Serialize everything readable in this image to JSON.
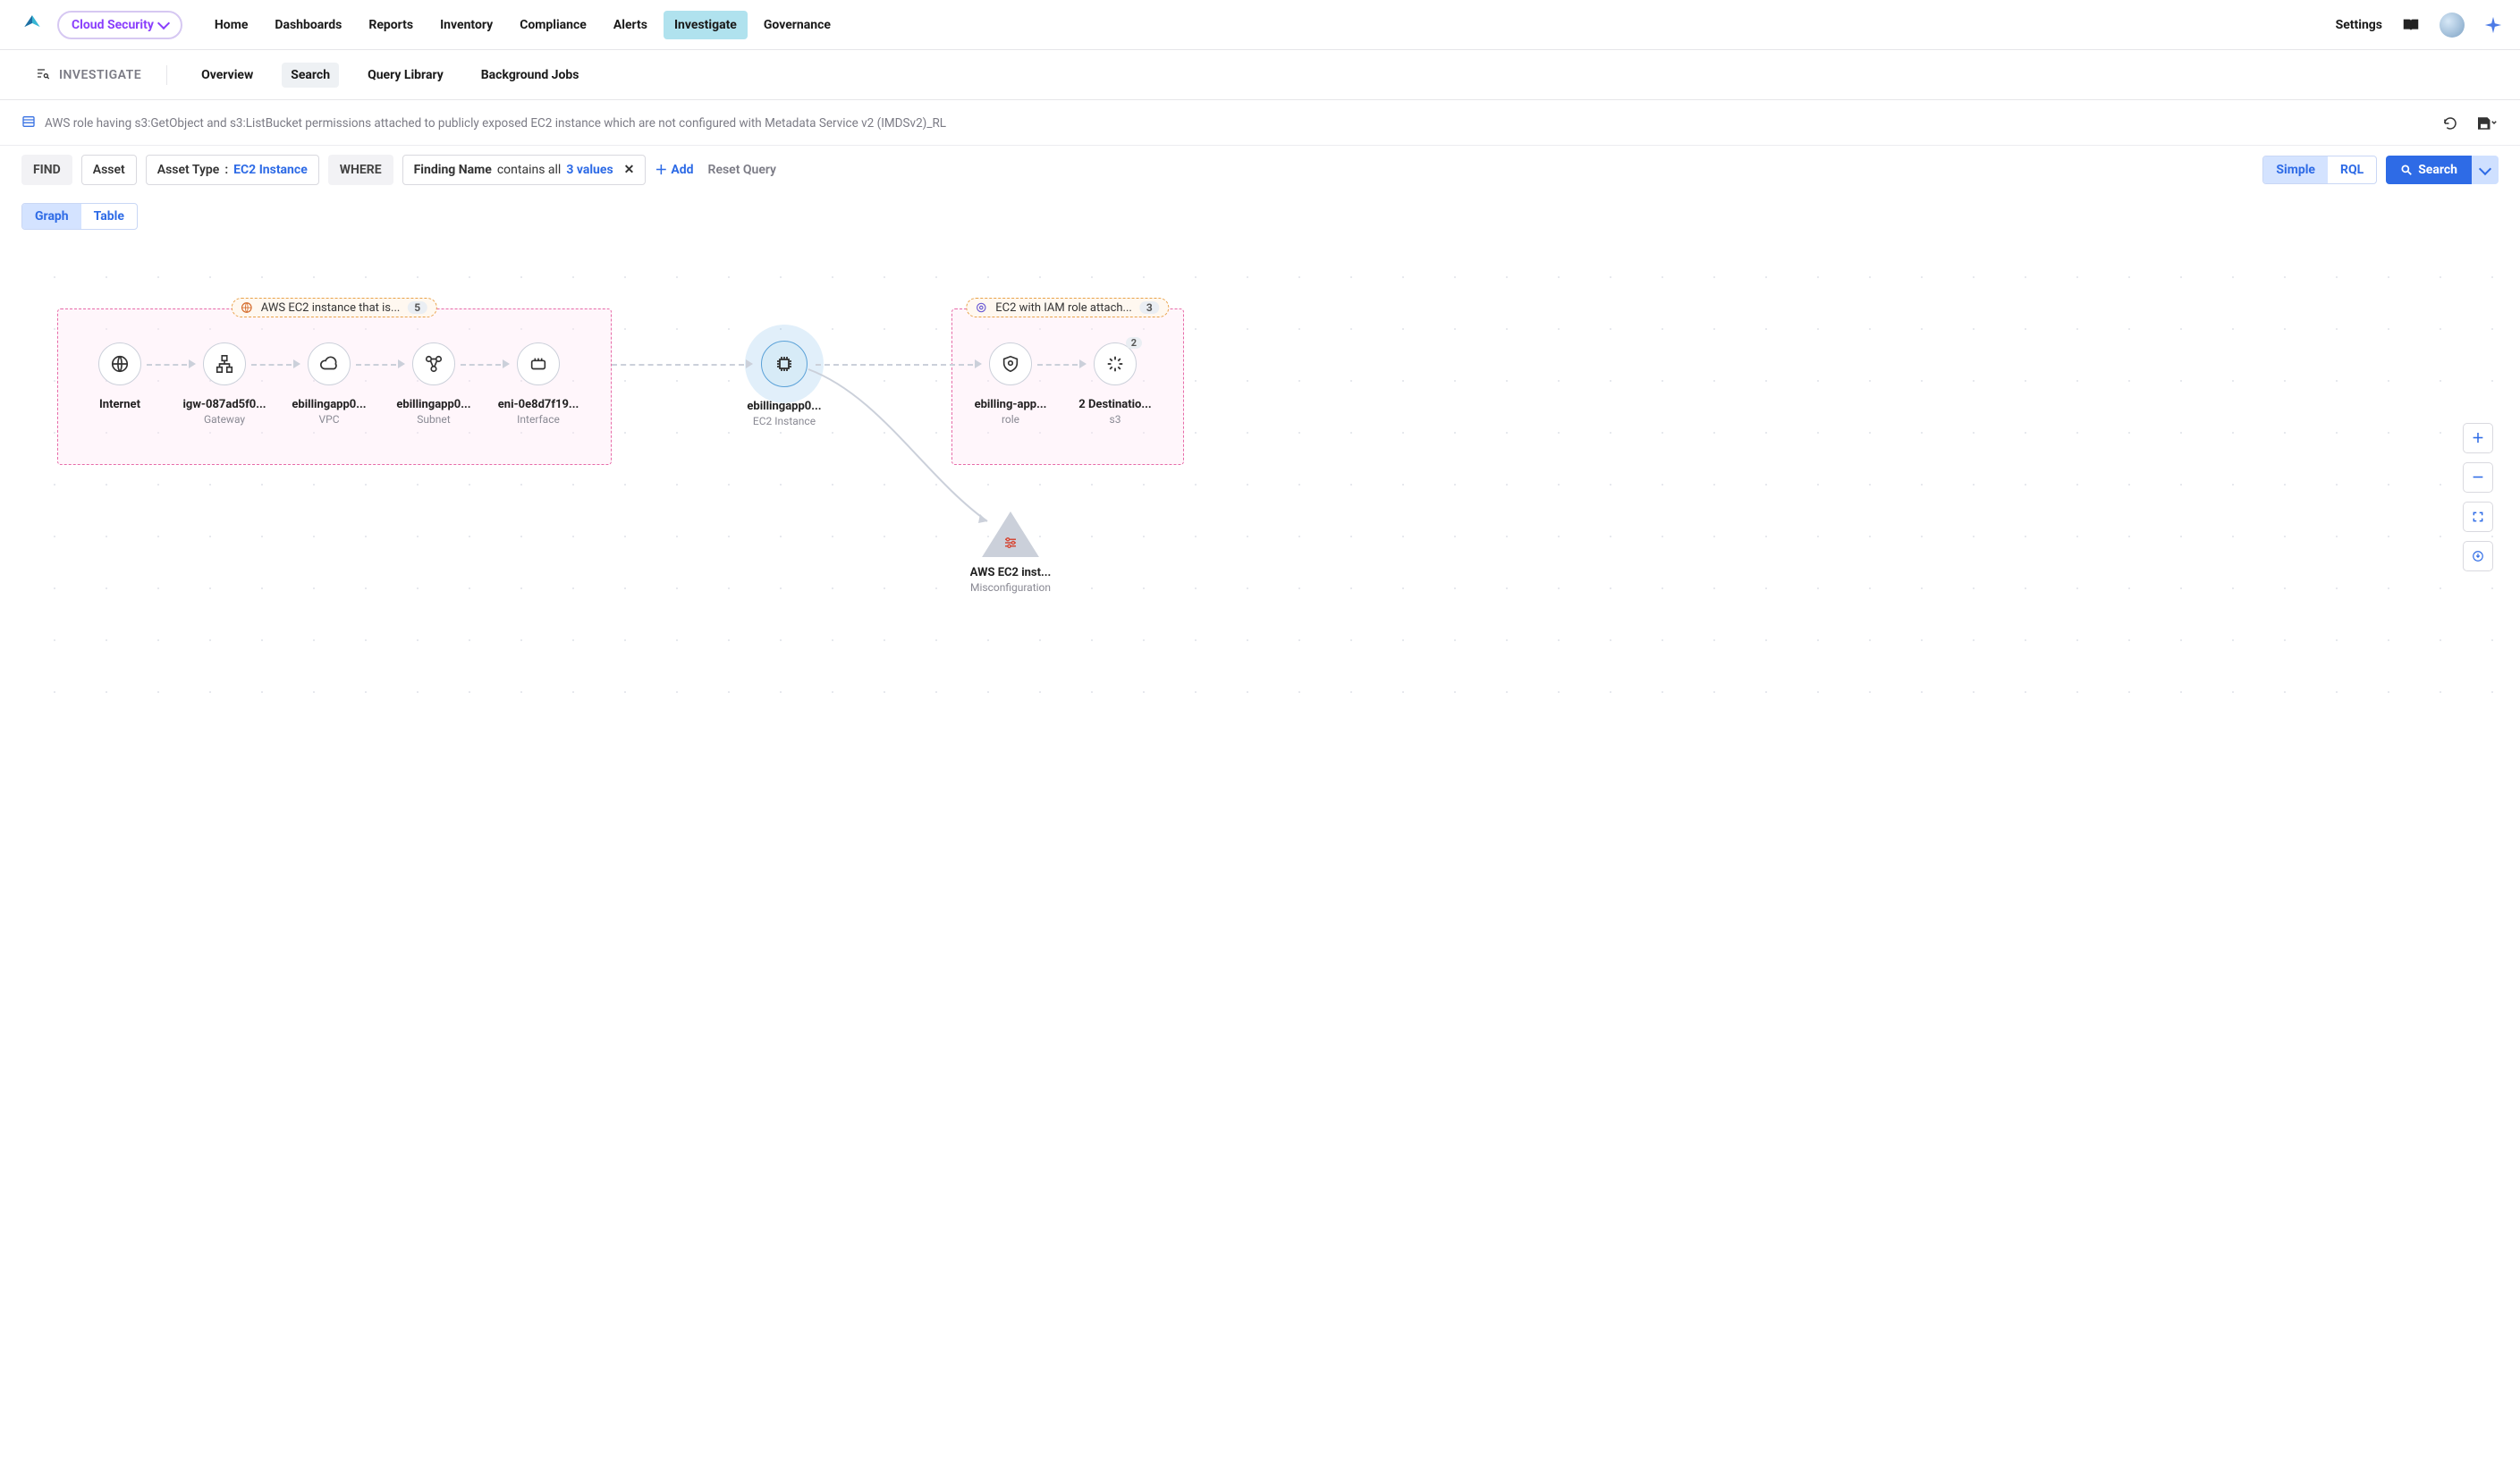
{
  "topbar": {
    "product_name": "Cloud Security",
    "nav": [
      "Home",
      "Dashboards",
      "Reports",
      "Inventory",
      "Compliance",
      "Alerts",
      "Investigate",
      "Governance"
    ],
    "active_nav_index": 6,
    "settings_label": "Settings"
  },
  "subnav": {
    "title": "INVESTIGATE",
    "tabs": [
      "Overview",
      "Search",
      "Query Library",
      "Background Jobs"
    ],
    "active_tab_index": 1
  },
  "query": {
    "description": "AWS role having s3:GetObject and s3:ListBucket permissions attached to publicly exposed EC2 instance which are not configured with Metadata Service v2 (IMDSv2)_RL",
    "find_label": "FIND",
    "asset_label": "Asset",
    "asset_type_label": "Asset Type",
    "asset_type_value": "EC2 Instance",
    "where_label": "WHERE",
    "finding_name_label": "Finding Name",
    "contains_label": "contains all",
    "values_text": "3 values",
    "add_label": "Add",
    "reset_label": "Reset Query",
    "mode_simple": "Simple",
    "mode_rql": "RQL",
    "search_label": "Search"
  },
  "view": {
    "graph_label": "Graph",
    "table_label": "Table",
    "active_index": 0
  },
  "graph": {
    "groups": {
      "left": {
        "label": "AWS EC2 instance that is...",
        "count": "5"
      },
      "right": {
        "label": "EC2 with IAM role attach...",
        "count": "3"
      }
    },
    "nodes": {
      "internet": {
        "label": "Internet",
        "sub": ""
      },
      "gateway": {
        "label": "igw-087ad5f0...",
        "sub": "Gateway"
      },
      "vpc": {
        "label": "ebillingapp0...",
        "sub": "VPC"
      },
      "subnet": {
        "label": "ebillingapp0...",
        "sub": "Subnet"
      },
      "interface": {
        "label": "eni-0e8d7f19...",
        "sub": "Interface"
      },
      "ec2": {
        "label": "ebillingapp0...",
        "sub": "EC2 Instance"
      },
      "role": {
        "label": "ebilling-app...",
        "sub": "role"
      },
      "s3": {
        "label": "2 Destinatio...",
        "sub": "s3",
        "badge": "2"
      },
      "misconfig": {
        "label": "AWS EC2 inst...",
        "sub": "Misconfiguration"
      }
    }
  },
  "colors": {
    "primary_blue": "#2e6be6",
    "active_tab_bg": "#b0e2ee",
    "product_purple": "#8a3ffc"
  }
}
